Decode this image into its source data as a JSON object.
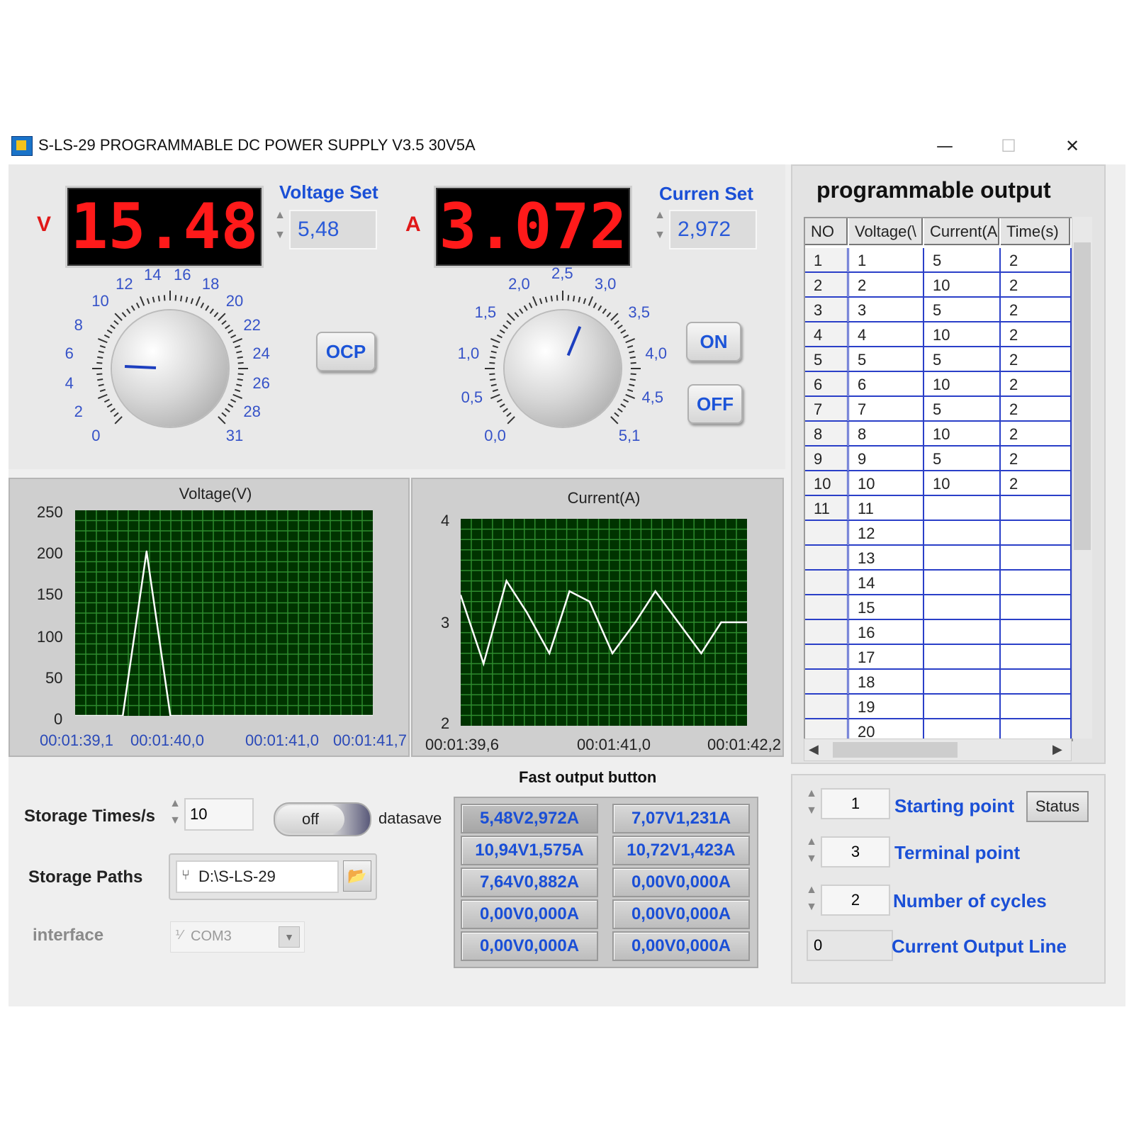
{
  "window": {
    "title": "S-LS-29 PROGRAMMABLE DC POWER SUPPLY V3.5  30V5A",
    "minimize": "—",
    "maximize": "☐",
    "close": "✕"
  },
  "voltage": {
    "unit": "V",
    "display": "15.48",
    "set_label": "Voltage Set",
    "set_value": "5,48",
    "dial_labels": [
      "0",
      "2",
      "4",
      "6",
      "8",
      "10",
      "12",
      "14",
      "16",
      "18",
      "20",
      "22",
      "24",
      "26",
      "28",
      "31"
    ],
    "knob_value": 5.48
  },
  "current": {
    "unit": "A",
    "display": "3.072",
    "set_label": "Curren Set",
    "set_value": "2,972",
    "dial_labels": [
      "0,0",
      "0,5",
      "1,0",
      "1,5",
      "2,0",
      "2,5",
      "3,0",
      "3,5",
      "4,0",
      "4,5",
      "5,1"
    ],
    "knob_value": 2.972
  },
  "buttons": {
    "ocp": "OCP",
    "on": "ON",
    "off": "OFF"
  },
  "chart_data": [
    {
      "type": "line",
      "title": "Voltage(V)",
      "ylim": [
        0,
        250
      ],
      "yticks": [
        "0",
        "50",
        "100",
        "150",
        "200",
        "250"
      ],
      "xticks": [
        "00:01:39,1",
        "00:01:40,0",
        "00:01:41,0",
        "00:01:41,7"
      ],
      "x": [
        0,
        0.16,
        0.24,
        0.32,
        1.0
      ],
      "y": [
        0,
        0,
        200,
        0,
        0
      ],
      "color": "#ffffff",
      "background": "#003300",
      "grid": true
    },
    {
      "type": "line",
      "title": "Current(A)",
      "ylim": [
        2,
        4
      ],
      "yticks": [
        "2",
        "3",
        "4"
      ],
      "xticks": [
        "00:01:39,6",
        "00:01:41,0",
        "00:01:42,2"
      ],
      "x": [
        0,
        0.08,
        0.16,
        0.23,
        0.31,
        0.38,
        0.45,
        0.53,
        0.61,
        0.68,
        0.76,
        0.84,
        0.91,
        1.0
      ],
      "y": [
        3.26,
        2.6,
        3.4,
        3.1,
        2.7,
        3.3,
        3.2,
        2.7,
        3.0,
        3.3,
        3.0,
        2.7,
        3.0,
        3.0
      ],
      "color": "#ffffff",
      "background": "#003300",
      "grid": true
    }
  ],
  "program": {
    "title": "programmable output",
    "headers": [
      "NO",
      "Voltage(\\",
      "Current(A",
      "Time(s)"
    ],
    "rows": [
      [
        "1",
        "1",
        "5",
        "2"
      ],
      [
        "2",
        "2",
        "10",
        "2"
      ],
      [
        "3",
        "3",
        "5",
        "2"
      ],
      [
        "4",
        "4",
        "10",
        "2"
      ],
      [
        "5",
        "5",
        "5",
        "2"
      ],
      [
        "6",
        "6",
        "10",
        "2"
      ],
      [
        "7",
        "7",
        "5",
        "2"
      ],
      [
        "8",
        "8",
        "10",
        "2"
      ],
      [
        "9",
        "9",
        "5",
        "2"
      ],
      [
        "10",
        "10",
        "10",
        "2"
      ],
      [
        "11",
        "11",
        "",
        ""
      ],
      [
        "",
        "12",
        "",
        ""
      ],
      [
        "",
        "13",
        "",
        ""
      ],
      [
        "",
        "14",
        "",
        ""
      ],
      [
        "",
        "15",
        "",
        ""
      ],
      [
        "",
        "16",
        "",
        ""
      ],
      [
        "",
        "17",
        "",
        ""
      ],
      [
        "",
        "18",
        "",
        ""
      ],
      [
        "",
        "19",
        "",
        ""
      ],
      [
        "",
        "20",
        "",
        ""
      ]
    ]
  },
  "storage": {
    "times_label": "Storage Times/s",
    "times_value": "10",
    "toggle_value": "off",
    "datasave_label": "datasave",
    "paths_label": "Storage  Paths",
    "path_value": "D:\\S-LS-29",
    "interface_label": "interface",
    "interface_value": "COM3"
  },
  "fast": {
    "title": "Fast output button",
    "buttons": [
      "5,48V2,972A",
      "7,07V1,231A",
      "10,94V1,575A",
      "10,72V1,423A",
      "7,64V0,882A",
      "0,00V0,000A",
      "0,00V0,000A",
      "0,00V0,000A",
      "0,00V0,000A",
      "0,00V0,000A"
    ]
  },
  "sequence": {
    "starting_value": "1",
    "starting_label": "Starting point",
    "status_label": "Status",
    "terminal_value": "3",
    "terminal_label": "Terminal point",
    "cycles_value": "2",
    "cycles_label": "Number of cycles",
    "output_line_value": "0",
    "output_line_label": "Current Output Line"
  }
}
